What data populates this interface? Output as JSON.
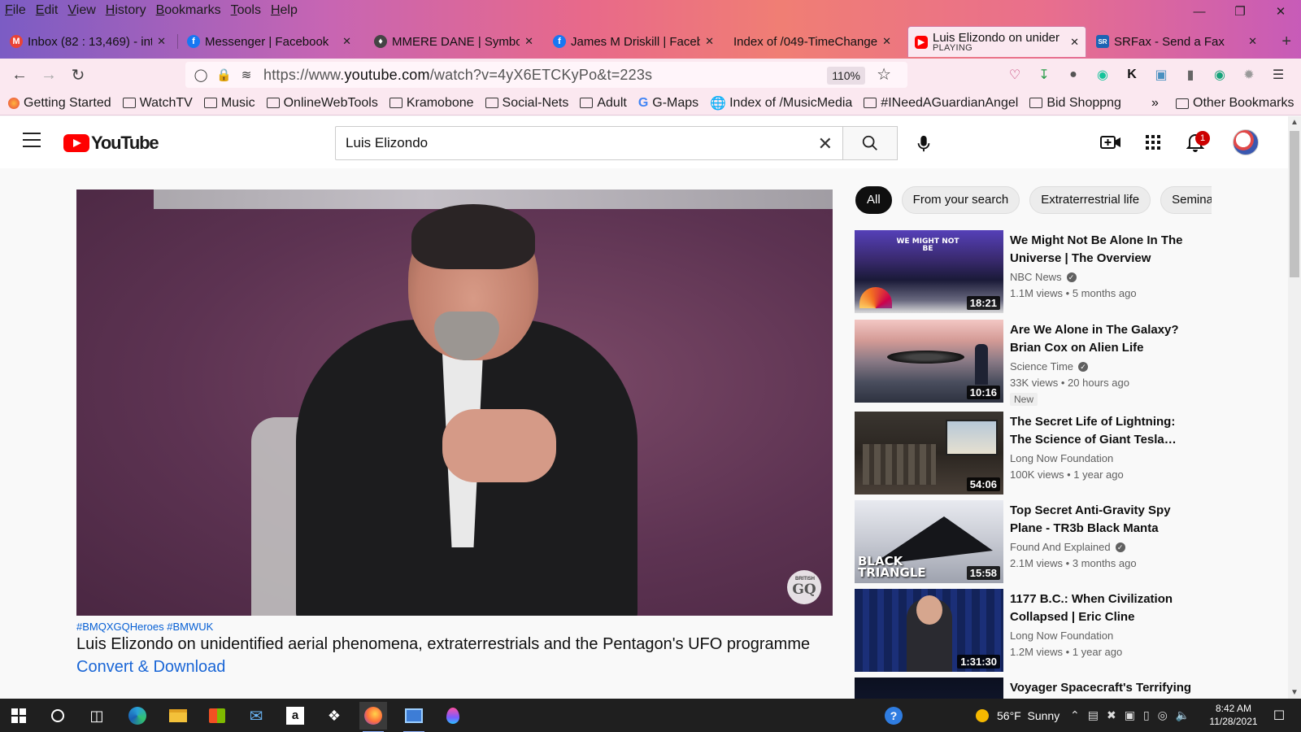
{
  "menu": [
    "File",
    "Edit",
    "View",
    "History",
    "Bookmarks",
    "Tools",
    "Help"
  ],
  "tabs": [
    {
      "label": "Inbox (82 : 13,469) - int",
      "icon": "gmail-icon",
      "color": "#ea4335"
    },
    {
      "label": "Messenger | Facebook",
      "icon": "facebook-icon",
      "color": "#1877f2"
    },
    {
      "label": "MMERE DANE | Symbol",
      "icon": "symbol-icon",
      "color": "#444444"
    },
    {
      "label": "James M Driskill | Faceb",
      "icon": "facebook-icon",
      "color": "#1877f2"
    },
    {
      "label": "Index of /049-TimeChange",
      "icon": "",
      "color": ""
    },
    {
      "label": "Luis Elizondo on unider",
      "sub": "PLAYING",
      "icon": "youtube-icon",
      "color": "#ff0000",
      "active": true
    },
    {
      "label": "SRFax - Send a Fax",
      "icon": "srfax-icon",
      "color": "#1b64b4"
    }
  ],
  "navbar": {
    "url_prefix": "https://www.",
    "url_domain": "youtube.com",
    "url_rest": "/watch?v=4yX6ETCKyPo&t=223s",
    "zoom": "110%"
  },
  "bookmarks": [
    {
      "label": "Getting Started",
      "type": "firefox"
    },
    {
      "label": "WatchTV",
      "type": "folder"
    },
    {
      "label": "Music",
      "type": "folder"
    },
    {
      "label": "OnlineWebTools",
      "type": "folder"
    },
    {
      "label": "Kramobone",
      "type": "folder"
    },
    {
      "label": "Social-Nets",
      "type": "folder"
    },
    {
      "label": "Adult",
      "type": "folder"
    },
    {
      "label": "G-Maps",
      "type": "google"
    },
    {
      "label": "Index of /MusicMedia",
      "type": "globe"
    },
    {
      "label": "#INeedAGuardianAngel",
      "type": "folder"
    },
    {
      "label": "Bid Shoppng",
      "type": "folder"
    }
  ],
  "bookmarks_other": "Other Bookmarks",
  "youtube": {
    "logo_text": "YouTube",
    "search_value": "Luis Elizondo",
    "notification_count": "1",
    "video": {
      "hashtags": "#BMQXGQHeroes #BMWUK",
      "title": "Luis Elizondo on unidentified aerial phenomena, extraterrestrials and the Pentagon's UFO programme",
      "convert_link": "Convert & Download",
      "watermark": "GQ",
      "watermark_small": "BRITISH"
    },
    "chips": [
      "All",
      "From your search",
      "Extraterrestrial life",
      "Semina"
    ],
    "recommended": [
      {
        "title": "We Might Not Be Alone In The Universe | The Overview",
        "channel": "NBC News",
        "verified": true,
        "views": "1.1M views",
        "age": "5 months ago",
        "duration": "18:21",
        "thumb_text": "WE MIGHT NOT BE"
      },
      {
        "title": "Are We Alone in The Galaxy? Brian Cox on Alien Life",
        "channel": "Science Time",
        "verified": true,
        "views": "33K views",
        "age": "20 hours ago",
        "duration": "10:16",
        "badge": "New"
      },
      {
        "title": "The Secret Life of Lightning: The Science of Giant Tesla…",
        "channel": "Long Now Foundation",
        "verified": false,
        "views": "100K views",
        "age": "1 year ago",
        "duration": "54:06"
      },
      {
        "title": "Top Secret Anti-Gravity Spy Plane - TR3b Black Manta",
        "channel": "Found And Explained",
        "verified": true,
        "views": "2.1M views",
        "age": "3 months ago",
        "duration": "15:58",
        "thumb_text": "BLACK TRIANGLE"
      },
      {
        "title": "1177 B.C.: When Civilization Collapsed | Eric Cline",
        "channel": "Long Now Foundation",
        "verified": false,
        "views": "1.2M views",
        "age": "1 year ago",
        "duration": "1:31:30"
      },
      {
        "title": "Voyager Spacecraft's Terrifying",
        "channel": "",
        "verified": false,
        "views": "",
        "age": "",
        "duration": ""
      }
    ]
  },
  "taskbar": {
    "temperature": "56°F",
    "weather": "Sunny",
    "time": "8:42 AM",
    "date": "11/28/2021"
  }
}
